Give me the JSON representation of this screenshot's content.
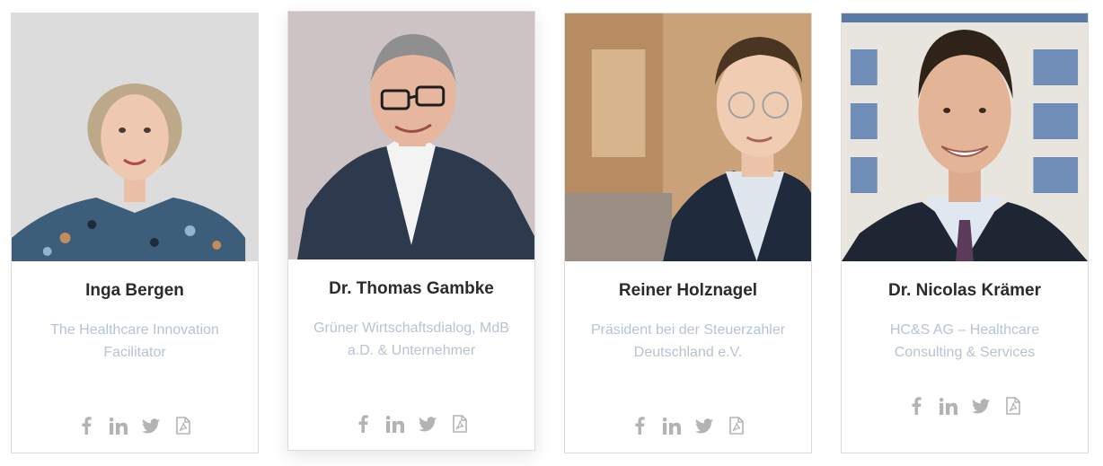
{
  "people": [
    {
      "name": "Inga Bergen",
      "role": "The Healthcare Innovation Facilitator",
      "social": [
        "facebook",
        "linkedin",
        "twitter",
        "pdf"
      ]
    },
    {
      "name": "Dr. Thomas Gambke",
      "role": "Grüner Wirtschaftsdialog, MdB a.D. & Unternehmer",
      "social": [
        "facebook",
        "linkedin",
        "twitter",
        "pdf"
      ]
    },
    {
      "name": "Reiner Holznagel",
      "role": "Präsident bei der Steuerzahler Deutschland e.V.",
      "social": [
        "facebook",
        "linkedin",
        "twitter",
        "pdf"
      ]
    },
    {
      "name": "Dr. Nicolas Krämer",
      "role": "HC&S AG – Healthcare Consulting & Services",
      "social": [
        "facebook",
        "linkedin",
        "twitter",
        "pdf"
      ]
    }
  ],
  "colors": {
    "name": "#2b2b2b",
    "role": "#b7c3d3",
    "icon": "#b3b3b3",
    "border": "#dcdcdc"
  }
}
